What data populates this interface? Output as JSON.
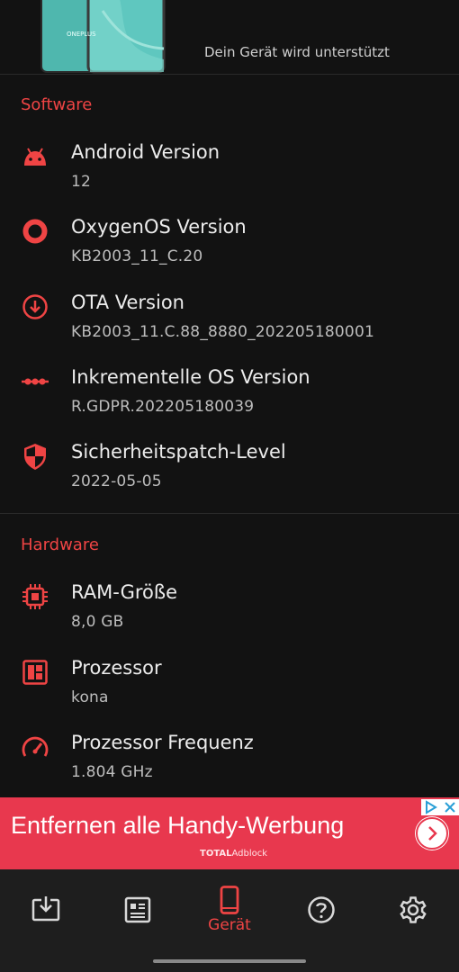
{
  "header": {
    "device_supported": "Dein Gerät wird unterstützt",
    "phone_brand_mark": "ONEPLUS"
  },
  "software": {
    "title": "Software",
    "items": [
      {
        "title": "Android Version",
        "value": "12",
        "icon": "android-icon"
      },
      {
        "title": "OxygenOS Version",
        "value": "KB2003_11_C.20",
        "icon": "oxygenos-ring-icon"
      },
      {
        "title": "OTA Version",
        "value": "KB2003_11.C.88_8880_202205180001",
        "icon": "download-circle-icon"
      },
      {
        "title": "Inkrementelle OS Version",
        "value": "R.GDPR.202205180039",
        "icon": "dots-line-icon"
      },
      {
        "title": "Sicherheitspatch-Level",
        "value": "2022-05-05",
        "icon": "shield-icon"
      }
    ]
  },
  "hardware": {
    "title": "Hardware",
    "items": [
      {
        "title": "RAM-Größe",
        "value": "8,0 GB",
        "icon": "chip-icon"
      },
      {
        "title": "Prozessor",
        "value": "kona",
        "icon": "processor-board-icon"
      },
      {
        "title": "Prozessor Frequenz",
        "value": "1.804 GHz",
        "icon": "speedometer-icon"
      }
    ]
  },
  "ad": {
    "headline": "Entfernen alle Handy-Werbung",
    "brand_bold": "TOTAL",
    "brand_rest": "Adblock"
  },
  "nav": {
    "active_label": "Gerät",
    "items": [
      "download-box-icon",
      "list-card-icon",
      "phone-icon",
      "help-icon",
      "settings-icon"
    ]
  },
  "colors": {
    "accent": "#ef4444",
    "background": "#121212",
    "nav_background": "#1e1e1e",
    "ad_background": "#e8384e"
  }
}
